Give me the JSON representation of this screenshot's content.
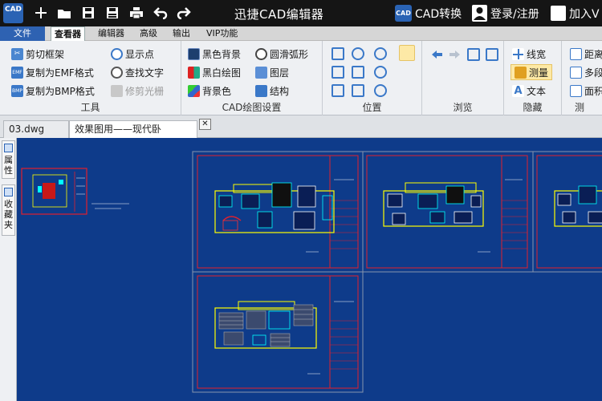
{
  "app": {
    "logo": "CAD",
    "title": "迅捷CAD编辑器"
  },
  "quick_access": [
    "new-icon",
    "open-icon",
    "save-icon",
    "save-as-icon",
    "print-icon",
    "undo-icon",
    "redo-icon"
  ],
  "title_right": {
    "convert_badge": "CAD",
    "convert_label": "CAD转换",
    "login_label": "登录/注册",
    "join_label": "加入V"
  },
  "menu": {
    "file": "文件",
    "items": [
      "查看器",
      "编辑器",
      "高级",
      "输出",
      "VIP功能"
    ],
    "active": "查看器"
  },
  "ribbon": {
    "tools": {
      "label": "工具",
      "items": [
        "剪切框架",
        "复制为EMF格式",
        "复制为BMP格式",
        "显示点",
        "查找文字",
        "修剪光栅"
      ]
    },
    "cad_settings": {
      "label": "CAD绘图设置",
      "items": [
        "黑色背景",
        "黑白绘图",
        "背景色",
        "圆滑弧形",
        "图层",
        "结构"
      ]
    },
    "position": {
      "label": "位置"
    },
    "browse": {
      "label": "浏览"
    },
    "hide": {
      "label": "隐藏",
      "items": [
        "线宽",
        "测量",
        "文本"
      ]
    },
    "measure": {
      "label": "测",
      "items": [
        "距离",
        "多段",
        "面积"
      ]
    }
  },
  "tabs": [
    {
      "label": "03.dwg"
    },
    {
      "label": "效果图用——现代卧室.dwg",
      "close": "✕"
    }
  ],
  "side_tabs": [
    "属性",
    "收藏夹"
  ],
  "colors": {
    "canvas": "#0e3b8a",
    "accent": "#2e62b2",
    "title_bar": "#151515",
    "frame": "#e0202e",
    "drawing": "#ffff00",
    "walls": "#00ffff"
  }
}
